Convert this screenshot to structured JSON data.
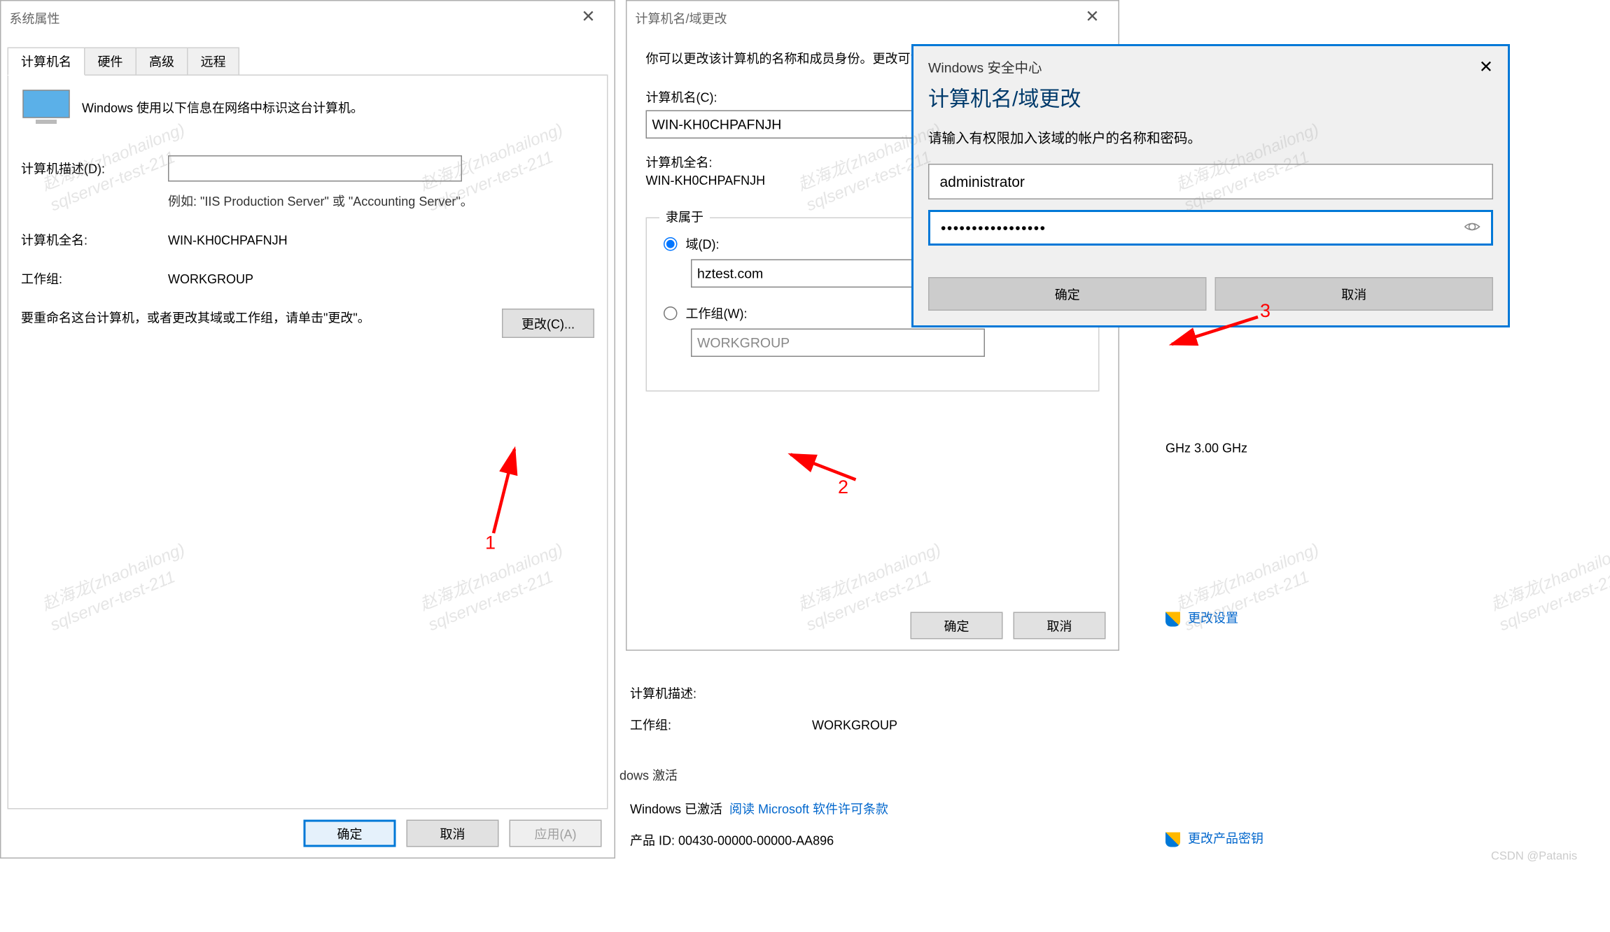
{
  "watermark": {
    "line1": "赵海龙(zhaohailong)",
    "line2": "sqlserver-test-211"
  },
  "dialog1": {
    "title": "系统属性",
    "tabs": [
      "计算机名",
      "硬件",
      "高级",
      "远程"
    ],
    "intro": "Windows 使用以下信息在网络中标识这台计算机。",
    "desc_label": "计算机描述(D):",
    "desc_value": "",
    "desc_example": "例如: \"IIS Production Server\" 或 \"Accounting Server\"。",
    "fullname_label": "计算机全名:",
    "fullname_value": "WIN-KH0CHPAFNJH",
    "workgroup_label": "工作组:",
    "workgroup_value": "WORKGROUP",
    "rename_text": "要重命名这台计算机，或者更改其域或工作组，请单击\"更改\"。",
    "change_btn": "更改(C)...",
    "ok": "确定",
    "cancel": "取消",
    "apply": "应用(A)"
  },
  "dialog2": {
    "title": "计算机名/域更改",
    "intro": "你可以更改该计算机的名称和成员身份。更改可能会影响对网络资源的访问。",
    "name_label": "计算机名(C):",
    "name_value": "WIN-KH0CHPAFNJH",
    "fullname_label": "计算机全名:",
    "fullname_value": "WIN-KH0CHPAFNJH",
    "member_legend": "隶属于",
    "domain_radio": "域(D):",
    "domain_value": "hztest.com",
    "workgroup_radio": "工作组(W):",
    "workgroup_value": "WORKGROUP",
    "ok": "确定",
    "cancel": "取消"
  },
  "cred": {
    "brand": "Windows 安全中心",
    "title": "计算机名/域更改",
    "prompt": "请输入有权限加入该域的帐户的名称和密码。",
    "username": "administrator",
    "password": "•••••••••••••••••",
    "ok": "确定",
    "cancel": "取消"
  },
  "bg": {
    "ghz": "GHz   3.00 GHz",
    "change_settings": "更改设置",
    "desc_label": "计算机描述:",
    "workgroup_label": "工作组:",
    "workgroup_value": "WORKGROUP",
    "activation_section": "dows 激活",
    "activation_status": "Windows 已激活",
    "license_link": "阅读 Microsoft 软件许可条款",
    "product_id": "产品 ID: 00430-00000-00000-AA896",
    "change_key": "更改产品密钥"
  },
  "annotations": {
    "n1": "1",
    "n2": "2",
    "n3": "3"
  },
  "footer": "CSDN @Patanis"
}
